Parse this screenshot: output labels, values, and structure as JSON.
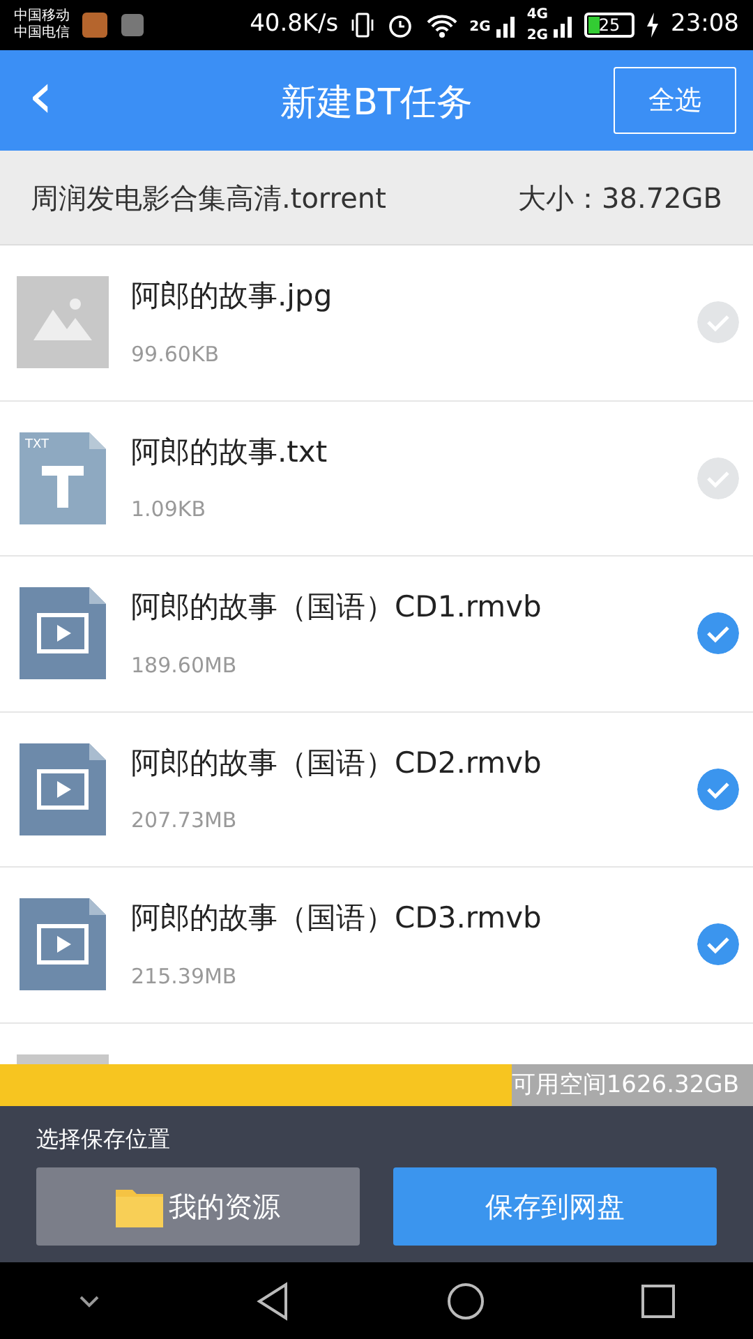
{
  "status_bar": {
    "carriers": [
      "中国移动",
      "中国电信"
    ],
    "speed": "40.8K/s",
    "network_labels": [
      "2G",
      "4G",
      "2G"
    ],
    "battery": "25",
    "time": "23:08"
  },
  "header": {
    "back": "‹",
    "title": "新建BT任务",
    "select_all": "全选"
  },
  "torrent": {
    "name": "周润发电影合集高清.torrent",
    "size": "大小：38.72GB"
  },
  "files": [
    {
      "kind": "image",
      "name": "阿郎的故事.jpg",
      "size": "99.60KB",
      "checked": false
    },
    {
      "kind": "text",
      "icon_label": "TXT",
      "name": "阿郎的故事.txt",
      "size": "1.09KB",
      "checked": false
    },
    {
      "kind": "video",
      "name": "阿郎的故事（国语）CD1.rmvb",
      "size": "189.60MB",
      "checked": true
    },
    {
      "kind": "video",
      "name": "阿郎的故事（国语）CD2.rmvb",
      "size": "207.73MB",
      "checked": true
    },
    {
      "kind": "video",
      "name": "阿郎的故事（国语）CD3.rmvb",
      "size": "215.39MB",
      "checked": true
    },
    {
      "kind": "partial"
    }
  ],
  "storage": {
    "level": 0.68,
    "free": "可用空间1626.32GB"
  },
  "save": {
    "label": "选择保存位置",
    "my_resources": "我的资源",
    "cloud": "保存到网盘"
  }
}
